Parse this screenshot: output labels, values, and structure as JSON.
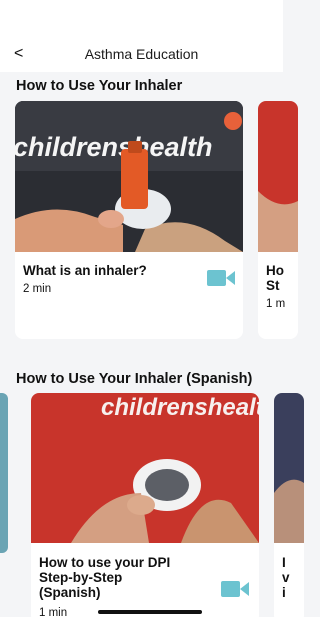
{
  "header": {
    "back_icon": "chevron-left-icon",
    "back_glyph": "<",
    "title": "Asthma Education"
  },
  "sections": [
    {
      "title": "How to Use Your Inhaler",
      "cards": [
        {
          "title": "What is an inhaler?",
          "duration": "2 min",
          "thumb_text": "childrenshealth",
          "icon": "video-camera-icon"
        },
        {
          "title": "Ho St",
          "title_line1": "Ho",
          "title_line2": "St",
          "duration": "1 m"
        }
      ]
    },
    {
      "title": "How to Use Your Inhaler (Spanish)",
      "cards": [
        {
          "title_line1": "How to use your DPI",
          "title_line2": "Step-by-Step",
          "title_line3": "(Spanish)",
          "duration": "1 min",
          "thumb_text": "childrenshealt",
          "icon": "video-camera-icon"
        },
        {
          "title_line1": "I",
          "title_line2": "v",
          "title_line3": "i"
        }
      ]
    }
  ],
  "colors": {
    "accent_video": "#6cc3d0",
    "thumb_bg_dark": "#2b2d33",
    "thumb_bg_red": "#c8342b",
    "inhaler_orange": "#e35a26",
    "logo_orange": "#e8613a"
  }
}
